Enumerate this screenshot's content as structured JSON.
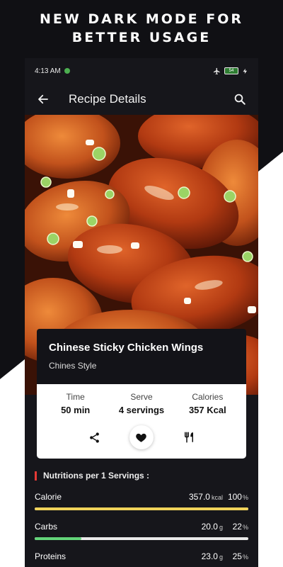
{
  "promo": {
    "line1": "NEW DARK MODE FOR",
    "line2": "BETTER USAGE"
  },
  "status_bar": {
    "time": "4:13 AM",
    "battery": "54"
  },
  "app_bar": {
    "title": "Recipe Details",
    "back_icon": "arrow-left",
    "search_icon": "magnifier"
  },
  "recipe": {
    "title": "Chinese Sticky Chicken Wings",
    "subtitle": "Chines Style",
    "stats": [
      {
        "label": "Time",
        "value": "50 min"
      },
      {
        "label": "Serve",
        "value": "4 servings"
      },
      {
        "label": "Calories",
        "value": "357 Kcal"
      }
    ],
    "actions": [
      "share-icon",
      "heart-icon",
      "fork-knife-icon"
    ]
  },
  "nutrition": {
    "heading": "Nutritions per 1 Servings :",
    "items": [
      {
        "name": "Calorie",
        "amount": "357.0",
        "unit": "kcal",
        "percent": "100",
        "pct_unit": "%",
        "fraction": 1.0,
        "color": "#f0d35a"
      },
      {
        "name": "Carbs",
        "amount": "20.0",
        "unit": "g",
        "percent": "22",
        "pct_unit": "%",
        "fraction": 0.22,
        "color": "#63d57a"
      },
      {
        "name": "Proteins",
        "amount": "23.0",
        "unit": "g",
        "percent": "25",
        "pct_unit": "%",
        "fraction": 0.25,
        "color": "#5aa7f0"
      }
    ]
  },
  "colors": {
    "background": "#101014",
    "accent_red": "#e53935",
    "card_dark": "#131318"
  }
}
